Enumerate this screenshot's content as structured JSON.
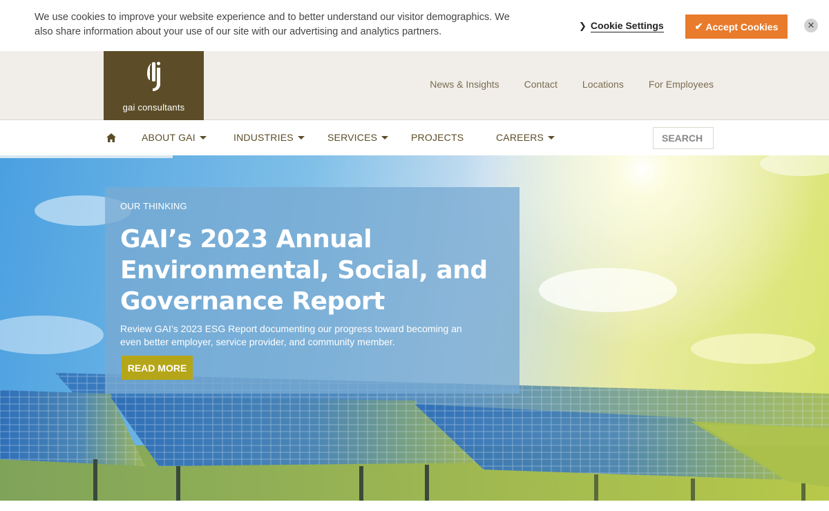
{
  "cookie": {
    "message": "We use cookies to improve your website experience and to better understand our visitor demographics. We also share information about your use of our site with our advertising and analytics partners.",
    "settings_label": "Cookie Settings",
    "accept_label": "Accept Cookies",
    "accept_color": "#e87b2c"
  },
  "header": {
    "logo_text": "gai consultants",
    "logo_color": "#5c4d28",
    "top_links": [
      "News & Insights",
      "Contact",
      "Locations",
      "For Employees"
    ]
  },
  "nav": {
    "home_icon": "home-icon",
    "items": [
      {
        "label": "ABOUT GAI",
        "has_dropdown": true
      },
      {
        "label": "INDUSTRIES",
        "has_dropdown": true
      },
      {
        "label": "SERVICES",
        "has_dropdown": true
      },
      {
        "label": "PROJECTS",
        "has_dropdown": false
      },
      {
        "label": "CAREERS",
        "has_dropdown": true
      }
    ],
    "search_placeholder": "SEARCH ."
  },
  "hero": {
    "kicker": "OUR THINKING",
    "title": "GAI’s 2023 Annual Environmental, Social, and Governance Report",
    "description": "Review GAI’s 2023 ESG Report documenting our progress toward becoming an even better employer, service provider, and community member.",
    "button_label": "READ MORE",
    "button_color": "#b5a619"
  }
}
